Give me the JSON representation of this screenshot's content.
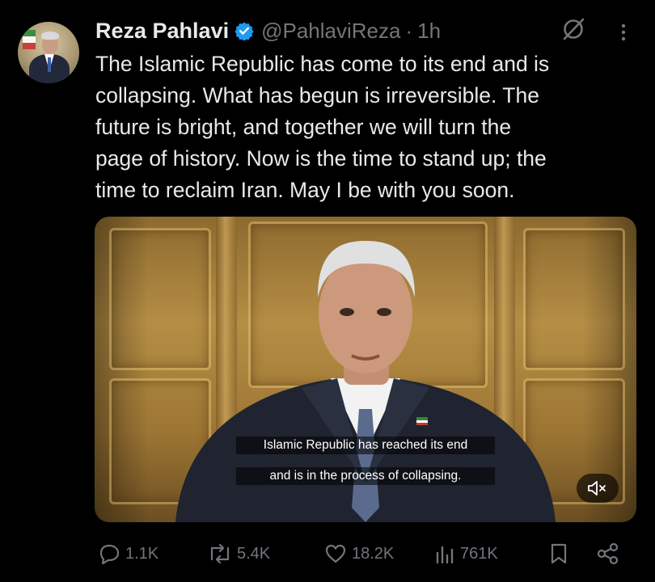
{
  "tweet": {
    "author": {
      "name": "Reza Pahlavi",
      "handle": "@PahlaviReza",
      "separator": "·",
      "time": "1h"
    },
    "text_lines": [
      "The Islamic Republic has come to its end and is",
      "collapsing. What has begun is irreversible. The",
      "future is bright, and together we will turn the",
      "page of history. Now is the time to stand up; the",
      "time to reclaim Iran. May I be with you soon."
    ],
    "media": {
      "caption_lines": [
        "Islamic Republic has reached its end",
        "and is in the process of collapsing."
      ],
      "audio": "muted"
    },
    "actions": {
      "replies": "1.1K",
      "reposts": "5.4K",
      "likes": "18.2K",
      "views": "761K"
    }
  },
  "icons": {
    "verified": "verified-badge-icon",
    "grok": "grok-icon",
    "more": "more-icon",
    "reply": "reply-icon",
    "repost": "repost-icon",
    "like": "like-icon",
    "views": "views-icon",
    "bookmark": "bookmark-icon",
    "share": "share-icon",
    "mute": "muted-speaker-icon"
  },
  "colors": {
    "background": "#000000",
    "text": "#e7e9ea",
    "secondary_text": "#71767b",
    "verified_blue": "#1d9bf0"
  }
}
